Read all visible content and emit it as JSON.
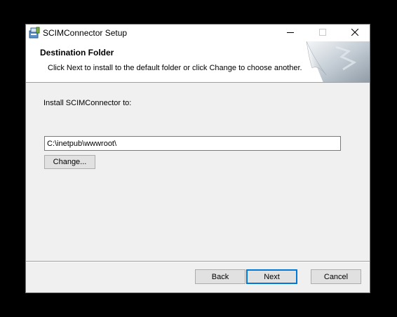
{
  "window": {
    "title": "SCIMConnector Setup"
  },
  "header": {
    "title": "Destination Folder",
    "description": "Click Next to install to the default folder or click Change to choose another."
  },
  "body": {
    "install_label": "Install SCIMConnector to:",
    "install_path": "C:\\inetpub\\wwwroot\\",
    "change_label": "Change..."
  },
  "footer": {
    "back_label": "Back",
    "next_label": "Next",
    "cancel_label": "Cancel"
  },
  "icons": {
    "app": "installer-icon",
    "minimize": "minimize-icon",
    "maximize": "maximize-icon",
    "close": "close-icon"
  },
  "colors": {
    "focus_accent": "#0078d7",
    "dialog_background": "#f0f0f0"
  }
}
